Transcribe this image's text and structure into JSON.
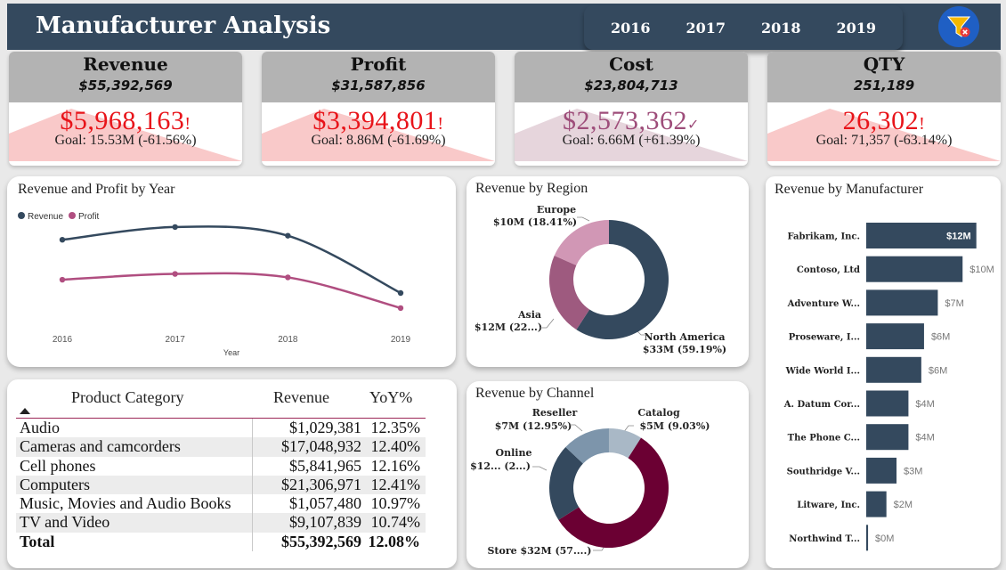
{
  "header": {
    "title": "Manufacturer Analysis",
    "years": [
      "2016",
      "2017",
      "2018",
      "2019"
    ],
    "filter_icon": "funnel-clear-icon"
  },
  "kpis": [
    {
      "title": "Revenue",
      "total": "$55,392,569",
      "value": "$5,968,163",
      "flag": "!",
      "goal": "Goal: 15.53M (-61.56%)",
      "status_color": "#e8141a",
      "fill": "#f9c9c9"
    },
    {
      "title": "Profit",
      "total": "$31,587,856",
      "value": "$3,394,801",
      "flag": "!",
      "goal": "Goal: 8.86M (-61.69%)",
      "status_color": "#e8141a",
      "fill": "#f9c9c9"
    },
    {
      "title": "Cost",
      "total": "$23,804,713",
      "value": "$2,573,362",
      "flag": "✓",
      "goal": "Goal: 6.66M (+61.39%)",
      "status_color": "#9e4d7a",
      "fill": "#e6d5dc"
    },
    {
      "title": "QTY",
      "total": "251,189",
      "value": "26,302",
      "flag": "!",
      "goal": "Goal: 71,357 (-63.14%)",
      "status_color": "#e8141a",
      "fill": "#f9c9c9"
    }
  ],
  "line_card": {
    "title": "Revenue and Profit by Year",
    "legend": [
      "Revenue",
      "Profit"
    ],
    "xlabel": "Year"
  },
  "region_card": {
    "title": "Revenue by Region",
    "labels": [
      {
        "name": "Europe",
        "value": "$10M (18.41%)"
      },
      {
        "name": "Asia",
        "value": "$12M (22...)"
      },
      {
        "name": "North America",
        "value": "$33M (59.19%)"
      }
    ]
  },
  "channel_card": {
    "title": "Revenue by Channel",
    "labels": [
      {
        "name": "Reseller",
        "value": "$7M (12.95%)"
      },
      {
        "name": "Catalog",
        "value": "$5M (9.03%)"
      },
      {
        "name": "Online",
        "value": "$12... (2...)"
      },
      {
        "name": "Store",
        "value": "$32M (57....)"
      }
    ]
  },
  "manufacturer_card": {
    "title": "Revenue by Manufacturer"
  },
  "table": {
    "headers": {
      "category": "Product Category",
      "revenue": "Revenue",
      "yoy": "YoY%"
    },
    "rows": [
      {
        "category": "Audio",
        "revenue": "$1,029,381",
        "yoy": "12.35%"
      },
      {
        "category": "Cameras and camcorders",
        "revenue": "$17,048,932",
        "yoy": "12.40%"
      },
      {
        "category": "Cell phones",
        "revenue": "$5,841,965",
        "yoy": "12.16%"
      },
      {
        "category": "Computers",
        "revenue": "$21,306,971",
        "yoy": "12.41%"
      },
      {
        "category": "Music, Movies and Audio Books",
        "revenue": "$1,057,480",
        "yoy": "10.97%"
      },
      {
        "category": "TV and Video",
        "revenue": "$9,107,839",
        "yoy": "10.74%"
      }
    ],
    "total": {
      "category": "Total",
      "revenue": "$55,392,569",
      "yoy": "12.08%"
    }
  },
  "colors": {
    "header_bg": "#34495e",
    "revenue_line": "#34495e",
    "profit_line": "#b04e80",
    "bar": "#34495e",
    "north_america": "#34495e",
    "asia": "#9e5a7f",
    "europe": "#d197b5",
    "store": "#6b0033",
    "online": "#34495e",
    "reseller": "#7d95ab",
    "catalog": "#a9b8c6"
  },
  "chart_data": [
    {
      "type": "line",
      "title": "Revenue and Profit by Year",
      "xlabel": "Year",
      "x": [
        "2016",
        "2017",
        "2018",
        "2019"
      ],
      "series": [
        {
          "name": "Revenue",
          "values": [
            15.2,
            17.4,
            15.9,
            6.0
          ]
        },
        {
          "name": "Profit",
          "values": [
            8.3,
            9.3,
            8.7,
            3.4
          ]
        }
      ],
      "ylim": [
        0,
        20
      ]
    },
    {
      "type": "pie",
      "title": "Revenue by Region",
      "categories": [
        "North America",
        "Asia",
        "Europe"
      ],
      "values": [
        59.19,
        22.4,
        18.41
      ],
      "labels": [
        "$33M (59.19%)",
        "$12M (22...)",
        "$10M (18.41%)"
      ]
    },
    {
      "type": "pie",
      "title": "Revenue by Channel",
      "categories": [
        "Store",
        "Online",
        "Reseller",
        "Catalog"
      ],
      "values": [
        57.0,
        21.0,
        12.95,
        9.03
      ],
      "labels": [
        "$32M (57....)",
        "$12... (2...)",
        "$7M (12.95%)",
        "$5M (9.03%)"
      ]
    },
    {
      "type": "bar",
      "title": "Revenue by Manufacturer",
      "categories": [
        "Fabrikam, Inc.",
        "Contoso, Ltd",
        "Adventure W...",
        "Proseware, I...",
        "Wide World I...",
        "A. Datum Cor...",
        "The Phone C...",
        "Southridge V...",
        "Litware, Inc.",
        "Northwind T..."
      ],
      "values": [
        12,
        10.5,
        7.8,
        6.3,
        6.0,
        4.6,
        4.6,
        3.3,
        2.2,
        0.2
      ],
      "labels": [
        "$12M",
        "$10M",
        "$7M",
        "$6M",
        "$6M",
        "$4M",
        "$4M",
        "$3M",
        "$2M",
        "$0M"
      ],
      "xlim": [
        0,
        13
      ]
    }
  ]
}
